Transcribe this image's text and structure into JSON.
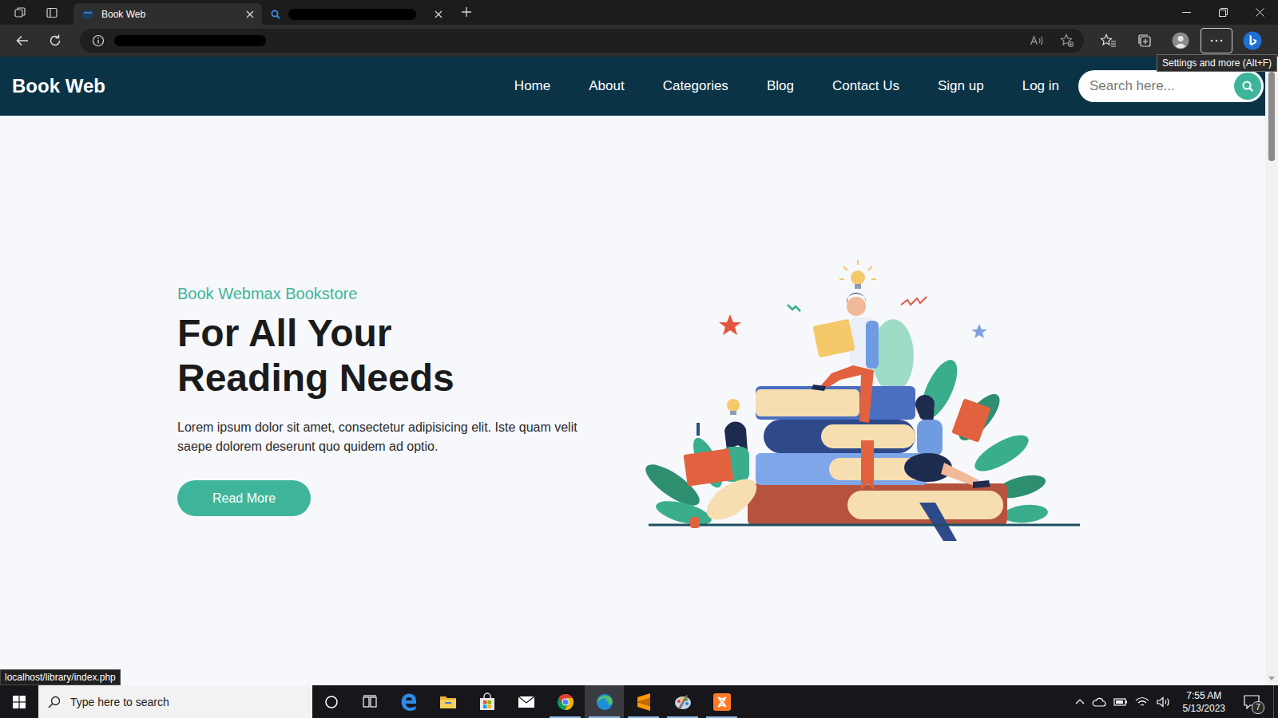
{
  "browser": {
    "tabs": [
      {
        "label": "Book Web",
        "selected": true,
        "redacted": false
      },
      {
        "selected": false,
        "redacted": true
      }
    ],
    "address": {
      "redacted": true
    },
    "tooltip": "Settings and more (Alt+F)",
    "status_link": "localhost/library/index.php"
  },
  "site": {
    "brand": "Book Web",
    "nav": [
      "Home",
      "About",
      "Categories",
      "Blog",
      "Contact Us",
      "Sign up",
      "Log in"
    ],
    "search": {
      "placeholder": "Search here..."
    },
    "hero": {
      "eyebrow": "Book Webmax Bookstore",
      "title": "For All Your Reading Needs",
      "text": "Lorem ipsum dolor sit amet, consectetur adipisicing elit. Iste quam velit saepe dolorem deserunt quo quidem ad optio.",
      "button": "Read More"
    }
  },
  "taskbar": {
    "search_placeholder": "Type here to search",
    "apps": [
      {
        "kind": "edge-legacy",
        "running": false,
        "selected": false
      },
      {
        "kind": "explorer",
        "running": false,
        "selected": false
      },
      {
        "kind": "store",
        "running": false,
        "selected": false
      },
      {
        "kind": "mail",
        "running": false,
        "selected": false
      },
      {
        "kind": "chrome",
        "running": true,
        "selected": false
      },
      {
        "kind": "edge",
        "running": true,
        "selected": true
      },
      {
        "kind": "sublime",
        "running": true,
        "selected": false
      },
      {
        "kind": "paint",
        "running": true,
        "selected": false
      },
      {
        "kind": "xampp",
        "running": true,
        "selected": false
      }
    ],
    "time": "7:55 AM",
    "date": "5/13/2023",
    "notifications": "7"
  }
}
